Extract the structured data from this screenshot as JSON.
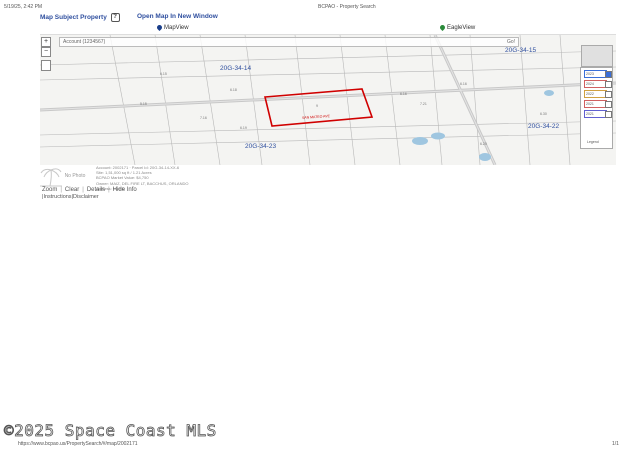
{
  "header": {
    "datetime": "5/19/25, 2:42 PM",
    "page_title": "BCPAO - Property Search"
  },
  "toolbar": {
    "map_subject_label": "Map Subject Property",
    "help_glyph": "?",
    "open_map_label": "Open Map In New Window"
  },
  "map_tabs": {
    "map_view": "MapView",
    "eagle_view": "EagleView",
    "map_view_color": "#1a3e8a",
    "eagle_view_color": "#2a8a3a"
  },
  "map": {
    "search_placeholder": "Account (1234567)",
    "search_button": "Go!",
    "zoom_in": "+",
    "zoom_out": "−",
    "labels": {
      "top_left": "20G-34-14",
      "top_right": "20G-34-15",
      "bottom_left": "20G-34-23",
      "bottom_right": "20G-34-22",
      "street": "SAN MATEO AVE"
    },
    "colors": {
      "subject_outline": "#d00000",
      "water": "#9fc6e0",
      "road": "#c8c8c8"
    },
    "legend": {
      "items": [
        "2023",
        "2024",
        "2022",
        "2021",
        "2021"
      ],
      "title": "Legend"
    }
  },
  "info": {
    "no_photo_label": "No Photo",
    "lines": [
      "Account: 2002171 · Parcel Id: 20G-34-14-XX-6",
      "Site: 1,51,000 sq ft / 1.21 Acres",
      "BCPAO Market Value: $4,750",
      "Owner: MAIZ, DEL FIRE LT, BACCHUS, ORLANDO",
      "Address: NONE"
    ]
  },
  "actions": {
    "zoom": "Zoom",
    "clear": "Clear",
    "details": "Details",
    "hide_info": "Hide Info",
    "instructions": "Instructions",
    "disclaimer": "Disclaimer"
  },
  "watermark": "©2025 Space Coast MLS",
  "footer": {
    "url": "https://www.bcpao.us/PropertySearch/#/map/2002171",
    "page": "1/1"
  }
}
